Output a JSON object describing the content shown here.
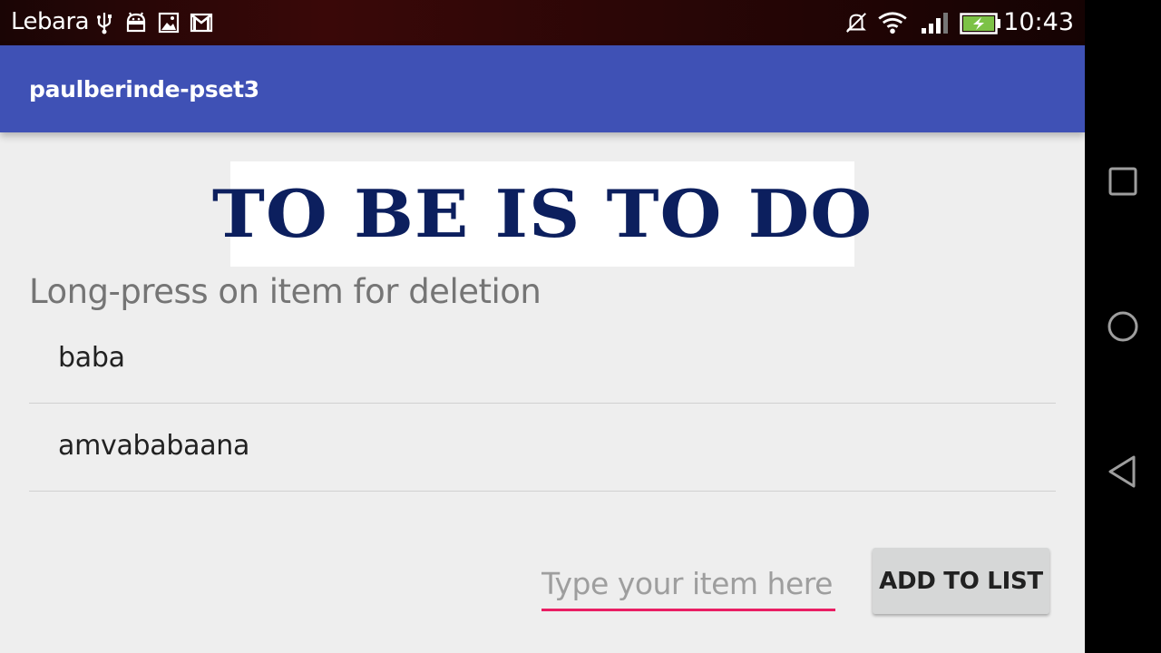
{
  "statusbar": {
    "carrier": "Lebara",
    "time": "10:43",
    "icons": [
      "usb-icon",
      "android-debug-icon",
      "image-notification-icon",
      "gmail-icon",
      "mute-icon",
      "wifi-icon",
      "signal-icon",
      "battery-charging-icon"
    ]
  },
  "appbar": {
    "title": "paulberinde-pset3",
    "color": "#3f51b5"
  },
  "banner": {
    "text": "TO BE IS TO DO"
  },
  "hint": "Long-press on item for deletion",
  "list": {
    "items": [
      {
        "label": "baba"
      },
      {
        "label": "amvababaana"
      }
    ]
  },
  "input": {
    "placeholder": "Type your item here!",
    "value": "",
    "accent": "#e91e63"
  },
  "button": {
    "label": "ADD TO LIST"
  },
  "navbar": {
    "icons": [
      "recents-icon",
      "home-icon",
      "back-icon"
    ]
  }
}
